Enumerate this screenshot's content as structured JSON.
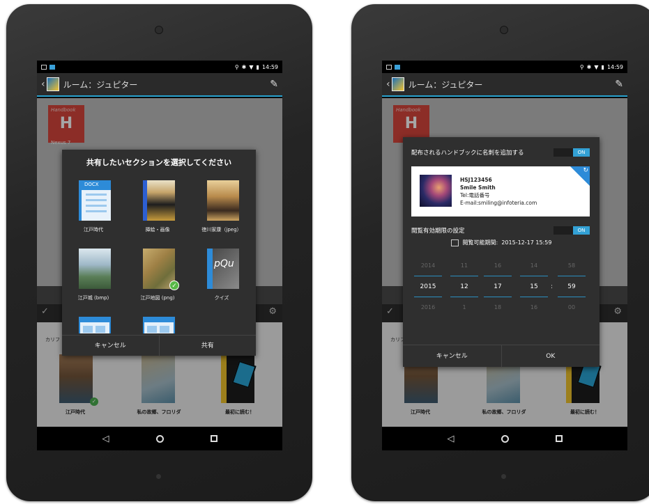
{
  "status": {
    "time": "14:59",
    "icons": [
      "location-icon",
      "bluetooth-icon",
      "wifi-icon",
      "battery-icon"
    ]
  },
  "actionbar": {
    "title": "ルーム：ジュピター"
  },
  "background": {
    "red_book_top": "Handbook",
    "red_book_letter": "H",
    "red_book_label": "Nexus 7",
    "cal_label": "カリフ",
    "items": [
      "江戸時代",
      "私の故郷、フロリダ",
      "最初に読む！"
    ]
  },
  "share_dialog": {
    "title": "共有したいセクションを選択してください",
    "items": [
      {
        "label": "江戸時代",
        "thumb_text": "DOCX"
      },
      {
        "label": "挿絵・画像"
      },
      {
        "label": "徳川家康（jpeg）"
      },
      {
        "label": "江戸城 (bmp)"
      },
      {
        "label": "江戸地図 (png)"
      },
      {
        "label": "クイズ",
        "thumb_text": "pQu"
      }
    ],
    "cancel": "キャンセル",
    "share": "共有"
  },
  "card_dialog": {
    "add_card_label": "配布されるハンドブックに名刺を追加する",
    "toggle_on": "ON",
    "card": {
      "id": "HSJ123456",
      "name": "Smile Smith",
      "tel": "Tel:電話番号",
      "email": "E-mail:smiling@infoteria.com"
    },
    "expiry_label": "閲覧有効期限の設定",
    "period_label": "閲覧可能期間:",
    "period_value": "2015-12-17 15:59",
    "picker": {
      "year": [
        "2014",
        "2015",
        "2016"
      ],
      "month": [
        "11",
        "12",
        "1"
      ],
      "day": [
        "16",
        "17",
        "18"
      ],
      "hour": [
        "14",
        "15",
        "16"
      ],
      "minute": [
        "58",
        "59",
        "00"
      ],
      "separator": ":"
    },
    "cancel": "キャンセル",
    "ok": "OK"
  }
}
